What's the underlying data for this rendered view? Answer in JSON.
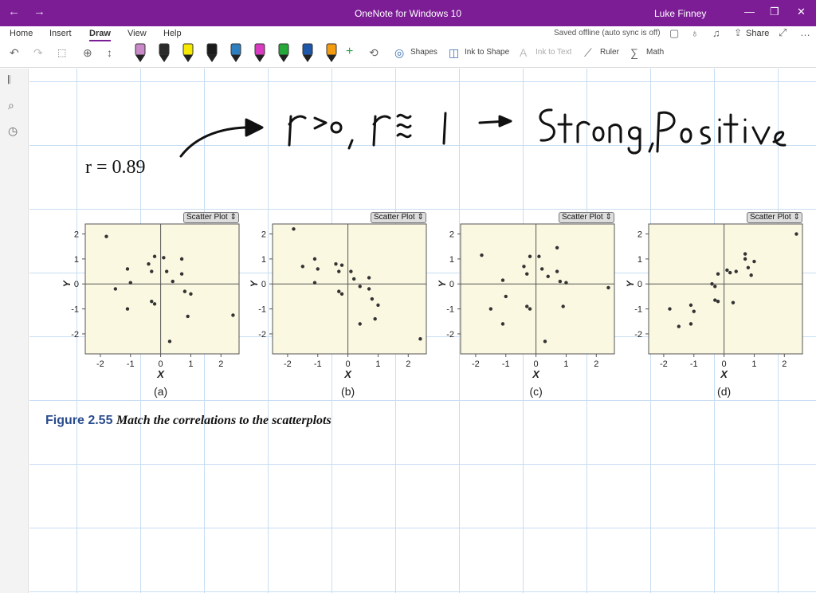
{
  "window": {
    "title": "OneNote for Windows 10",
    "user": "Luke Finney"
  },
  "ribbon": {
    "tabs": [
      "Home",
      "Insert",
      "Draw",
      "View",
      "Help"
    ],
    "status": "Saved offline (auto sync is off)",
    "share": "Share",
    "tools": {
      "shapes": "Shapes",
      "ink_to_shape": "Ink to Shape",
      "ink_to_text": "Ink to Text",
      "ruler": "Ruler",
      "math": "Math"
    },
    "pen_colors": [
      "#c989c9",
      "#2b2b2b",
      "#f6e800",
      "#1b1b1b",
      "#2d7fc0",
      "#d83bbf",
      "#27a83a",
      "#1e56a8",
      "#f39c12"
    ]
  },
  "note": {
    "formula": "r = 0.89",
    "handwriting": "r>0, r≈1 → Strong, Positive",
    "caption_label": "Figure 2.55",
    "caption_text": "Match the correlations to the scatterplots"
  },
  "plot_common": {
    "dropdown_label": "Scatter Plot",
    "xlabel": "X",
    "ylabel": "Y",
    "xticks": [
      "-2",
      "-1",
      "0",
      "1",
      "2"
    ],
    "yticks": [
      "2",
      "1",
      "0",
      "-1",
      "-2"
    ]
  },
  "chart_data": [
    {
      "type": "scatter",
      "label": "(a)",
      "xlim": [
        -2.5,
        2.6
      ],
      "ylim": [
        -2.8,
        2.4
      ],
      "points": [
        [
          -1.8,
          1.9
        ],
        [
          -1.5,
          -0.2
        ],
        [
          -1.1,
          0.6
        ],
        [
          -1.1,
          -1.0
        ],
        [
          -1.0,
          0.05
        ],
        [
          -0.4,
          0.8
        ],
        [
          -0.3,
          0.5
        ],
        [
          -0.3,
          -0.7
        ],
        [
          -0.2,
          -0.8
        ],
        [
          -0.2,
          1.1
        ],
        [
          0.1,
          1.05
        ],
        [
          0.2,
          0.5
        ],
        [
          0.4,
          0.1
        ],
        [
          0.7,
          1.0
        ],
        [
          0.7,
          0.4
        ],
        [
          0.8,
          -0.3
        ],
        [
          0.9,
          -1.3
        ],
        [
          1.0,
          -0.4
        ],
        [
          0.3,
          -2.3
        ],
        [
          2.4,
          -1.25
        ]
      ]
    },
    {
      "type": "scatter",
      "label": "(b)",
      "xlim": [
        -2.5,
        2.6
      ],
      "ylim": [
        -2.8,
        2.4
      ],
      "points": [
        [
          -1.8,
          2.2
        ],
        [
          -1.5,
          0.7
        ],
        [
          -1.1,
          1.0
        ],
        [
          -1.1,
          0.05
        ],
        [
          -1.0,
          0.6
        ],
        [
          -0.4,
          0.8
        ],
        [
          -0.3,
          0.5
        ],
        [
          -0.3,
          -0.3
        ],
        [
          -0.2,
          -0.4
        ],
        [
          -0.2,
          0.75
        ],
        [
          0.1,
          0.5
        ],
        [
          0.2,
          0.2
        ],
        [
          0.4,
          -0.1
        ],
        [
          0.7,
          0.25
        ],
        [
          0.7,
          -0.2
        ],
        [
          0.8,
          -0.6
        ],
        [
          0.9,
          -1.4
        ],
        [
          1.0,
          -0.85
        ],
        [
          0.4,
          -1.6
        ],
        [
          2.4,
          -2.2
        ]
      ]
    },
    {
      "type": "scatter",
      "label": "(c)",
      "xlim": [
        -2.5,
        2.6
      ],
      "ylim": [
        -2.8,
        2.4
      ],
      "points": [
        [
          -1.8,
          1.15
        ],
        [
          -1.5,
          -1.0
        ],
        [
          -1.1,
          -1.6
        ],
        [
          -1.1,
          0.15
        ],
        [
          -1.0,
          -0.5
        ],
        [
          -0.4,
          0.7
        ],
        [
          -0.3,
          0.4
        ],
        [
          -0.3,
          -0.9
        ],
        [
          -0.2,
          -1.0
        ],
        [
          -0.2,
          1.1
        ],
        [
          0.1,
          1.1
        ],
        [
          0.2,
          0.6
        ],
        [
          0.4,
          0.3
        ],
        [
          0.7,
          1.45
        ],
        [
          0.7,
          0.5
        ],
        [
          0.8,
          0.1
        ],
        [
          0.9,
          -0.9
        ],
        [
          1.0,
          0.05
        ],
        [
          0.3,
          -2.3
        ],
        [
          2.4,
          -0.15
        ]
      ]
    },
    {
      "type": "scatter",
      "label": "(d)",
      "xlim": [
        -2.5,
        2.6
      ],
      "ylim": [
        -2.8,
        2.4
      ],
      "points": [
        [
          -1.8,
          -1.0
        ],
        [
          -1.5,
          -1.7
        ],
        [
          -1.1,
          -1.6
        ],
        [
          -1.1,
          -0.85
        ],
        [
          -1.0,
          -1.1
        ],
        [
          -0.4,
          0.0
        ],
        [
          -0.3,
          -0.65
        ],
        [
          -0.3,
          -0.1
        ],
        [
          -0.2,
          -0.7
        ],
        [
          -0.2,
          0.4
        ],
        [
          0.1,
          0.55
        ],
        [
          0.2,
          0.45
        ],
        [
          0.4,
          0.5
        ],
        [
          0.7,
          1.2
        ],
        [
          0.7,
          1.0
        ],
        [
          0.8,
          0.65
        ],
        [
          0.9,
          0.35
        ],
        [
          1.0,
          0.9
        ],
        [
          0.3,
          -0.75
        ],
        [
          2.4,
          2.0
        ]
      ]
    }
  ]
}
